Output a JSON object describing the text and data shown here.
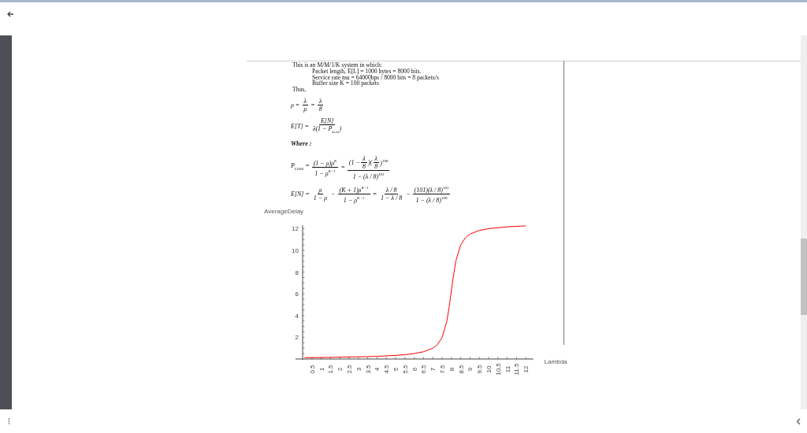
{
  "document": {
    "lines": [
      {
        "kind": "plain",
        "text": "This is an M/M/1/K system in which:"
      },
      {
        "kind": "indent",
        "text": "Packet length, E[L] = 1000 bytes = 8000 bits."
      },
      {
        "kind": "indent",
        "text": "Service rate mu = 64000bps / 8000 bits = 8 packets/s"
      },
      {
        "kind": "indent",
        "text": "Buffer size K = 100 packets"
      },
      {
        "kind": "plain",
        "text": "Thus,"
      }
    ],
    "formulas": [
      {
        "kind": "equation",
        "parts": [
          {
            "kind": "text",
            "text": "ρ ="
          },
          {
            "kind": "frac",
            "num": [
              {
                "kind": "text",
                "text": "λ"
              }
            ],
            "den": [
              {
                "kind": "text",
                "text": "μ"
              }
            ]
          },
          {
            "kind": "text",
            "text": "="
          },
          {
            "kind": "frac",
            "num": [
              {
                "kind": "text",
                "text": "λ"
              }
            ],
            "den": [
              {
                "kind": "text",
                "text": "8"
              }
            ]
          }
        ]
      },
      {
        "kind": "equation",
        "parts": [
          {
            "kind": "text",
            "text": "E[T] ="
          },
          {
            "kind": "frac",
            "num": [
              {
                "kind": "text",
                "text": "E[N]"
              }
            ],
            "den": [
              {
                "kind": "text",
                "text": "λ(1 − P$_{Loss}$)"
              }
            ]
          }
        ]
      },
      {
        "kind": "label",
        "parts": [
          {
            "kind": "text",
            "text": "Where :"
          }
        ]
      },
      {
        "kind": "equation",
        "parts": [
          {
            "kind": "text",
            "text": "P$_{LOSS}$ ="
          },
          {
            "kind": "frac",
            "num": [
              {
                "kind": "text",
                "text": "(1 − ρ)ρ$^{K}$"
              }
            ],
            "den": [
              {
                "kind": "text",
                "text": "1 − ρ$^{K+1}$"
              }
            ]
          },
          {
            "kind": "text",
            "text": "="
          },
          {
            "kind": "frac",
            "num": [
              {
                "kind": "text",
                "text": "(1 −"
              },
              {
                "kind": "frac",
                "num": [
                  {
                    "kind": "text",
                    "text": "λ"
                  }
                ],
                "den": [
                  {
                    "kind": "text",
                    "text": "8"
                  }
                ]
              },
              {
                "kind": "text",
                "text": ")("
              },
              {
                "kind": "frac",
                "num": [
                  {
                    "kind": "text",
                    "text": "λ"
                  }
                ],
                "den": [
                  {
                    "kind": "text",
                    "text": "8"
                  }
                ]
              },
              {
                "kind": "text",
                "text": ")$^{100}$"
              }
            ],
            "den": [
              {
                "kind": "text",
                "text": "1 − (λ / 8)$^{101}$"
              }
            ]
          }
        ]
      },
      {
        "kind": "equation",
        "parts": [
          {
            "kind": "text",
            "text": "E[N] ="
          },
          {
            "kind": "frac",
            "num": [
              {
                "kind": "text",
                "text": "ρ"
              }
            ],
            "den": [
              {
                "kind": "text",
                "text": "1 − ρ"
              }
            ]
          },
          {
            "kind": "text",
            "text": "−"
          },
          {
            "kind": "frac",
            "num": [
              {
                "kind": "text",
                "text": "(K + 1)ρ$^{K+1}$"
              }
            ],
            "den": [
              {
                "kind": "text",
                "text": "1 − ρ$^{K+1}$"
              }
            ]
          },
          {
            "kind": "text",
            "text": "="
          },
          {
            "kind": "frac",
            "num": [
              {
                "kind": "text",
                "text": "λ / 8"
              }
            ],
            "den": [
              {
                "kind": "text",
                "text": "1 − λ / 8"
              }
            ]
          },
          {
            "kind": "text",
            "text": "−"
          },
          {
            "kind": "frac",
            "num": [
              {
                "kind": "text",
                "text": "(101)(λ / 8)$^{101}$"
              }
            ],
            "den": [
              {
                "kind": "text",
                "text": "1 − (λ / 8)$^{100}$"
              }
            ]
          }
        ]
      }
    ],
    "chart_data": {
      "type": "line",
      "xlabel": "Lambda",
      "ylabel": "AverageDelay",
      "x": [
        0.1,
        0.5,
        1,
        1.5,
        2,
        2.5,
        3,
        3.5,
        4,
        4.5,
        5,
        5.5,
        6,
        6.5,
        7,
        7.25,
        7.5,
        7.75,
        7.875,
        8,
        8.125,
        8.25,
        8.5,
        8.75,
        9,
        9.5,
        10,
        11,
        12
      ],
      "series": [
        {
          "color": "#ff0000",
          "values": [
            0.13,
            0.13,
            0.14,
            0.15,
            0.17,
            0.18,
            0.2,
            0.22,
            0.25,
            0.29,
            0.33,
            0.4,
            0.5,
            0.67,
            1.0,
            1.33,
            1.98,
            3.46,
            4.76,
            6.31,
            7.86,
            9.1,
            10.5,
            11.17,
            11.5,
            11.83,
            12.0,
            12.17,
            12.25
          ]
        }
      ],
      "xlim": [
        0,
        12.4
      ],
      "ylim": [
        0,
        12.3
      ],
      "xticks": [
        0.5,
        1,
        1.5,
        2,
        2.5,
        3,
        3.5,
        4,
        4.5,
        5,
        5.5,
        6,
        6.5,
        7,
        7.5,
        8,
        8.5,
        9,
        9.5,
        10,
        10.5,
        11,
        11.5,
        12
      ],
      "yticks": [
        2,
        4,
        6,
        8,
        10,
        12
      ]
    }
  },
  "corner_mark": "["
}
